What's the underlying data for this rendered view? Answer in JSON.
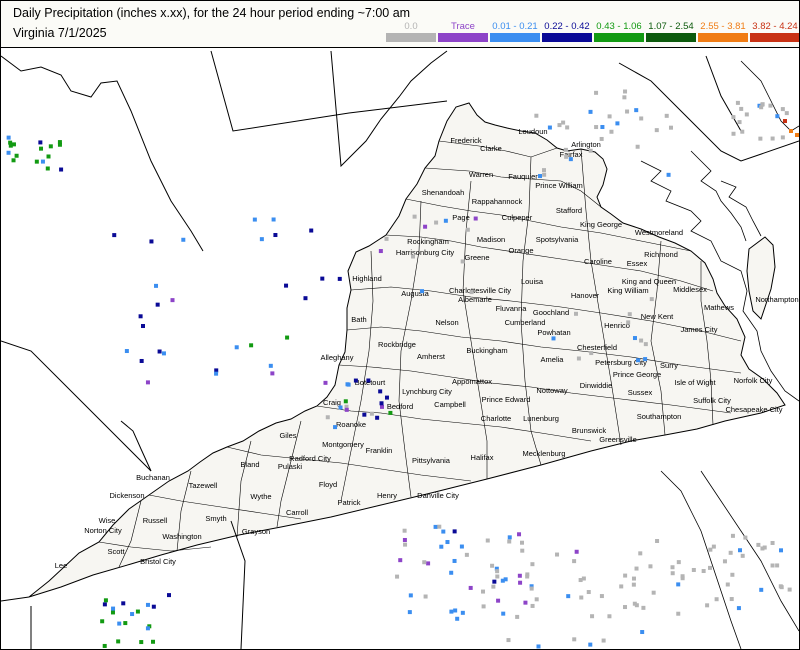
{
  "header": {
    "title": "Daily Precipitation (inches  x.xx),  for the 24 hour period ending ~7:00 am",
    "subtitle": "Virginia 7/1/2025"
  },
  "legend": [
    {
      "label": "0.0",
      "color": "#b4b4b4"
    },
    {
      "label": "Trace",
      "color": "#8d44c8"
    },
    {
      "label": "0.01 - 0.21",
      "color": "#3b8ef0"
    },
    {
      "label": "0.22 - 0.42",
      "color": "#0a0a96"
    },
    {
      "label": "0.43 - 1.06",
      "color": "#129a12"
    },
    {
      "label": "1.07 - 2.54",
      "color": "#0c5a0c"
    },
    {
      "label": "2.55 - 3.81",
      "color": "#f07c14"
    },
    {
      "label": "3.82 - 4.24",
      "color": "#c83214"
    }
  ],
  "counties": [
    "Loudoun",
    "Frederick",
    "Clarke",
    "Arlington",
    "Fairfax",
    "Warren",
    "Fauquier",
    "Prince William",
    "Shenandoah",
    "Rappahannock",
    "Page",
    "Culpeper",
    "Stafford",
    "King George",
    "Westmoreland",
    "Rockingham",
    "Harrisonburg City",
    "Madison",
    "Spotsylvania",
    "Greene",
    "Orange",
    "Caroline",
    "Essex",
    "Richmond",
    "Highland",
    "Augusta",
    "Charlottesville City",
    "Albemarle",
    "Louisa",
    "Hanover",
    "King and Queen",
    "King William",
    "Middlesex",
    "Mathews",
    "Northampton",
    "Bath",
    "Nelson",
    "Fluvanna",
    "Goochland",
    "Cumberland",
    "Powhatan",
    "New Kent",
    "James City",
    "Henrico",
    "Rockbridge",
    "Alleghany",
    "Amherst",
    "Buckingham",
    "Chesterfield",
    "Amelia",
    "Petersburg City",
    "Prince George",
    "Surry",
    "Isle of Wight",
    "Norfolk City",
    "Botetourt",
    "Appomattox",
    "Lynchburg City",
    "Nottoway",
    "Dinwiddie",
    "Sussex",
    "Suffolk City",
    "Chesapeake City",
    "Craig",
    "Bedford",
    "Campbell",
    "Prince Edward",
    "Southampton",
    "Roanoke",
    "Montgomery",
    "Giles",
    "Charlotte",
    "Lunenburg",
    "Brunswick",
    "Greensville",
    "Radford City",
    "Pulaski",
    "Franklin",
    "Pittsylvania",
    "Halifax",
    "Mecklenburg",
    "Buchanan",
    "Bland",
    "Tazewell",
    "Floyd",
    "Dickenson",
    "Wythe",
    "Patrick",
    "Henry",
    "Danville City",
    "Carroll",
    "Wise",
    "Russell",
    "Smyth",
    "Norton City",
    "Washington",
    "Grayson",
    "Scott",
    "Bristol City",
    "Lee"
  ],
  "map_colors": {
    "state_fill": "#f7f6f2",
    "line": "#000000",
    "background": "#ffffff"
  }
}
